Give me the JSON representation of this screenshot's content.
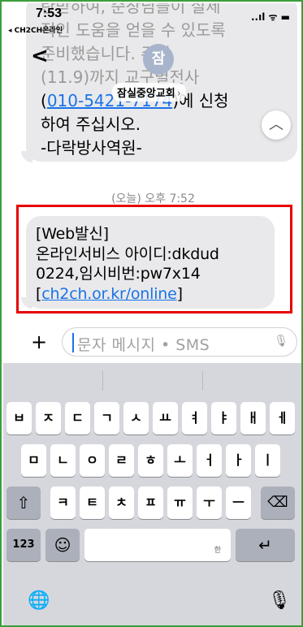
{
  "status": {
    "time": "7:53",
    "carrier": "◂ CH2CH온라인",
    "icons": "..ıl ᯤ ▬"
  },
  "header": {
    "back_glyph": "<",
    "avatar": "잠",
    "contact_name": "잠실중앙교회",
    "chevron": "›"
  },
  "prev_message": {
    "line1": "탄받하여, 순장님들이 실제",
    "line2": "적인 도움을 얻을 수 있도록",
    "line3": "준비했습니다. 주일",
    "line4": "(11.9)까지 교구별전사",
    "phone": "010-5421-7174",
    "line5_suffix": ")에 신청",
    "line6": "하여 주십시오.",
    "line7": " -다락방사역원-"
  },
  "timestamp": "(오늘) 오후 7:52",
  "message": {
    "line1": "[Web발신]",
    "line2": "온라인서비스 아이디:dkdud",
    "line3": "0224,임시비번:pw7x14",
    "link_open": "[",
    "link": "ch2ch.or.kr/online",
    "link_close": "]"
  },
  "input": {
    "plus": "+",
    "placeholder": "문자 메시지 • SMS",
    "mic": "🎙"
  },
  "keyboard": {
    "row1": [
      "ㅂ",
      "ㅈ",
      "ㄷ",
      "ㄱ",
      "ㅅ",
      "ㅛ",
      "ㅕ",
      "ㅑ",
      "ㅐ",
      "ㅔ"
    ],
    "row2": [
      "ㅁ",
      "ㄴ",
      "ㅇ",
      "ㄹ",
      "ㅎ",
      "ㅗ",
      "ㅓ",
      "ㅏ",
      "ㅣ"
    ],
    "row3": [
      "ㅋ",
      "ㅌ",
      "ㅊ",
      "ㅍ",
      "ㅠ",
      "ㅜ",
      "ㅡ"
    ],
    "shift": "⇧",
    "delete": "⌫",
    "numbers": "123",
    "emoji": "☺",
    "space_hint": "한",
    "return": "↵",
    "globe": "🌐",
    "mic": "🎙"
  },
  "colors": {
    "bubble": "#e9e9eb",
    "link": "#1a73e8",
    "highlight": "#e60000",
    "keyboard": "#d5d7dd"
  }
}
